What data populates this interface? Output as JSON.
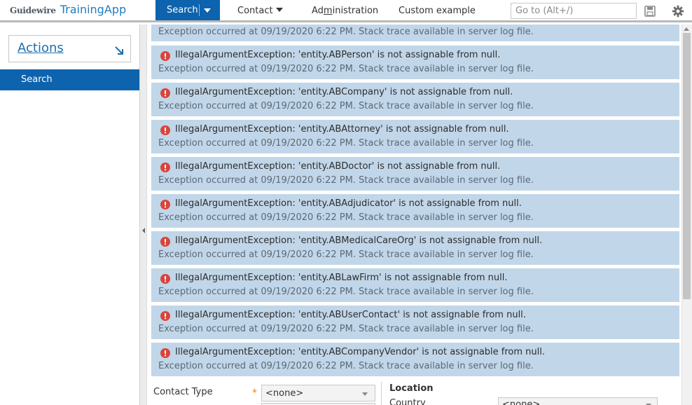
{
  "header": {
    "brand_company": "Guidewire",
    "brand_app": "TrainingApp",
    "tabs": {
      "search": "Search",
      "contact": "Contact",
      "admin_prefix": "Ad",
      "admin_underline": "m",
      "admin_suffix": "inistration",
      "custom": "Custom example"
    },
    "goto_placeholder": "Go to (Alt+/)"
  },
  "sidebar": {
    "actions_label": "Actions",
    "items": [
      {
        "label": "Search"
      }
    ]
  },
  "messages": {
    "top_detail": "Exception occurred at 09/19/2020 6:22 PM. Stack trace available in server log file.",
    "items": [
      {
        "title": "IllegalArgumentException: 'entity.ABPerson' is not assignable from null.",
        "detail": "Exception occurred at 09/19/2020 6:22 PM. Stack trace available in server log file."
      },
      {
        "title": "IllegalArgumentException: 'entity.ABCompany' is not assignable from null.",
        "detail": "Exception occurred at 09/19/2020 6:22 PM. Stack trace available in server log file."
      },
      {
        "title": "IllegalArgumentException: 'entity.ABAttorney' is not assignable from null.",
        "detail": "Exception occurred at 09/19/2020 6:22 PM. Stack trace available in server log file."
      },
      {
        "title": "IllegalArgumentException: 'entity.ABDoctor' is not assignable from null.",
        "detail": "Exception occurred at 09/19/2020 6:22 PM. Stack trace available in server log file."
      },
      {
        "title": "IllegalArgumentException: 'entity.ABAdjudicator' is not assignable from null.",
        "detail": "Exception occurred at 09/19/2020 6:22 PM. Stack trace available in server log file."
      },
      {
        "title": "IllegalArgumentException: 'entity.ABMedicalCareOrg' is not assignable from null.",
        "detail": "Exception occurred at 09/19/2020 6:22 PM. Stack trace available in server log file."
      },
      {
        "title": "IllegalArgumentException: 'entity.ABLawFirm' is not assignable from null.",
        "detail": "Exception occurred at 09/19/2020 6:22 PM. Stack trace available in server log file."
      },
      {
        "title": "IllegalArgumentException: 'entity.ABUserContact' is not assignable from null.",
        "detail": "Exception occurred at 09/19/2020 6:22 PM. Stack trace available in server log file."
      },
      {
        "title": "IllegalArgumentException: 'entity.ABCompanyVendor' is not assignable from null.",
        "detail": "Exception occurred at 09/19/2020 6:22 PM. Stack trace available in server log file."
      }
    ]
  },
  "form": {
    "contact_type_label": "Contact Type",
    "required_marker": "*",
    "contact_type_value": "<none>",
    "location_heading": "Location",
    "country_label": "Country",
    "country_value": "<none>"
  },
  "colors": {
    "accent": "#0d63ad",
    "message_bg": "#c1d6e8",
    "error_icon": "#d9453a"
  }
}
